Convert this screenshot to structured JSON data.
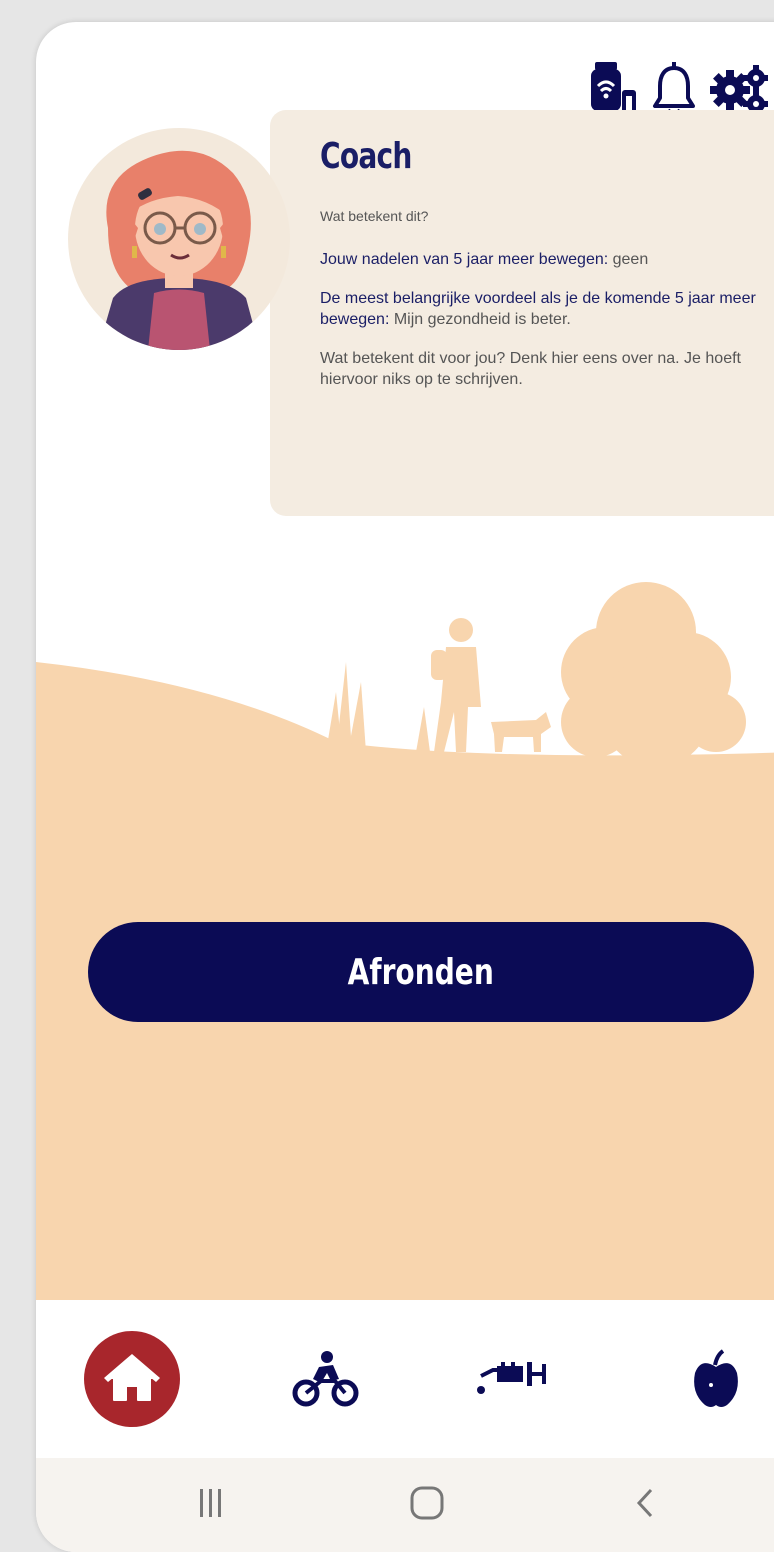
{
  "header": {
    "icons": [
      "smartwatch-icon",
      "bell-icon",
      "settings-gears-icon"
    ]
  },
  "coach": {
    "title": "Coach",
    "question": "Wat betekent dit?",
    "disadvantages_label": "Jouw nadelen van 5 jaar meer bewegen:",
    "disadvantages_value": " geen",
    "advantage_label": "De meest belangrijke voordeel als je de komende 5 jaar meer bewegen:",
    "advantage_value": " Mijn gezondheid is beter.",
    "reflection": "Wat betekent dit voor jou? Denk hier eens over na. Je hoeft hiervoor niks op te schrijven."
  },
  "cta": {
    "label": "Afronden"
  },
  "bottom_nav": {
    "items": [
      {
        "icon": "home-icon",
        "active": true
      },
      {
        "icon": "bicycle-icon",
        "active": false
      },
      {
        "icon": "sprinkler-icon",
        "active": false
      },
      {
        "icon": "apple-icon",
        "active": false
      }
    ]
  },
  "system_nav": {
    "icons": [
      "recent-apps-icon",
      "home-circle-icon",
      "back-icon"
    ]
  },
  "colors": {
    "navy": "#0b0b55",
    "title_navy": "#1a1e66",
    "peach": "#f8d5ae",
    "card_bg": "#f4ece1",
    "home_red": "#a8262c"
  }
}
